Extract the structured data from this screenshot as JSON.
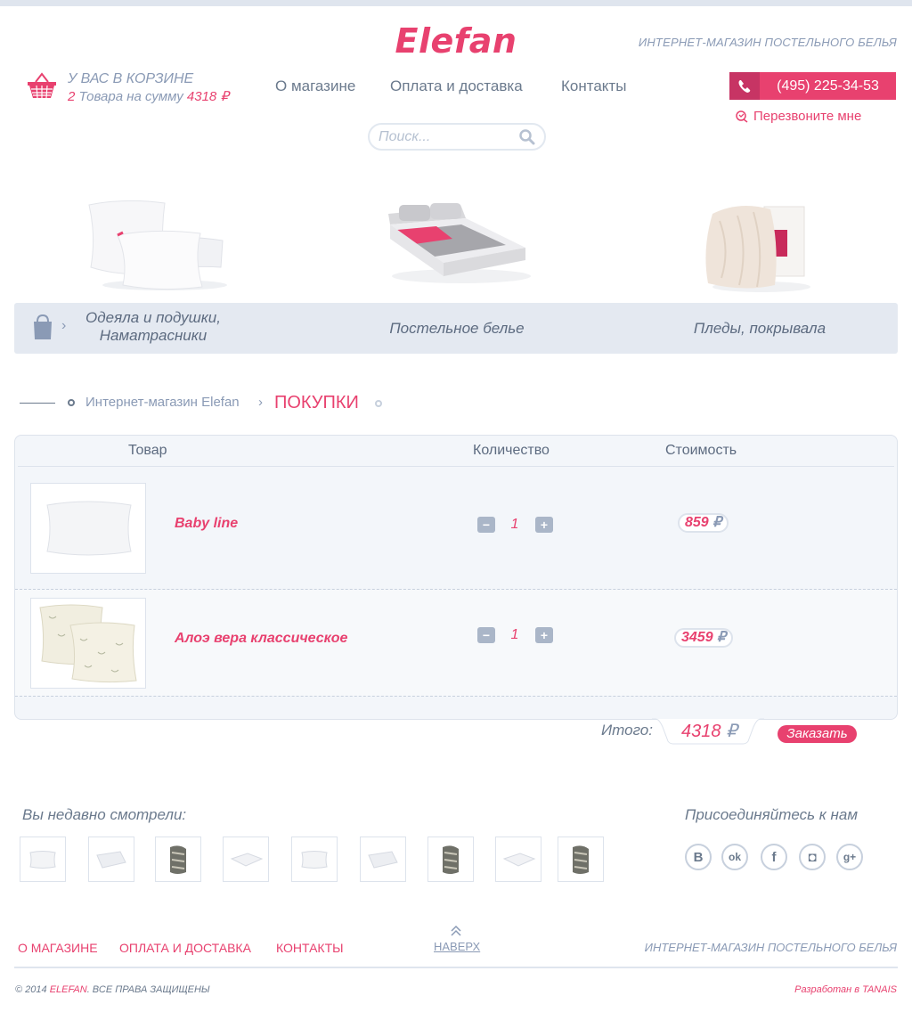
{
  "header": {
    "logo": "Elefan",
    "tagline": "ИНТЕРНЕТ-МАГАЗИН ПОСТЕЛЬНОГО БЕЛЬЯ",
    "cart_title": "У ВАС В КОРЗИНЕ",
    "cart_count": "2",
    "cart_goods_text": "Товара на сумму",
    "cart_sum": "4318",
    "currency": "₽",
    "nav": [
      "О магазине",
      "Оплата и доставка",
      "Контакты"
    ],
    "phone": "(495) 225-34-53",
    "callback": "Перезвоните мне",
    "search_placeholder": "Поиск..."
  },
  "categories": [
    {
      "label_line1": "Одеяла и подушки,",
      "label_line2": "Наматрасники",
      "icon": "pillows-image"
    },
    {
      "label_line1": "Постельное белье",
      "label_line2": "",
      "icon": "bed-image"
    },
    {
      "label_line1": "Пледы, покрывала",
      "label_line2": "",
      "icon": "blanket-image"
    }
  ],
  "breadcrumb": {
    "home": "Интернет-магазин Elefan",
    "separator": "›",
    "current": "ПОКУПКИ"
  },
  "cart_table": {
    "headers": {
      "product": "Товар",
      "quantity": "Количество",
      "cost": "Стоимость"
    },
    "items": [
      {
        "name": "Baby line",
        "quantity": "1",
        "price": "859",
        "image": "white-pillow-image"
      },
      {
        "name": "Алоэ вера классическое",
        "quantity": "1",
        "price": "3459",
        "image": "patterned-pillows-image"
      }
    ],
    "minus": "−",
    "plus": "+",
    "total_label": "Итого:",
    "total": "4318",
    "order_button": "Заказать"
  },
  "recent": {
    "title": "Вы недавно смотрели:",
    "items": [
      "pillow",
      "blanket",
      "throw",
      "folded-sheet",
      "pillow",
      "blanket",
      "throw",
      "folded-sheet",
      "throw"
    ]
  },
  "social": {
    "title": "Присоединяйтесь к нам",
    "networks": [
      {
        "name": "vk-icon",
        "glyph": "B"
      },
      {
        "name": "odnoklassniki-icon",
        "glyph": "ok"
      },
      {
        "name": "facebook-icon",
        "glyph": "f"
      },
      {
        "name": "instagram-icon",
        "glyph": "◘"
      },
      {
        "name": "google-plus-icon",
        "glyph": "g+"
      }
    ]
  },
  "footer": {
    "links": [
      "О МАГАЗИНЕ",
      "ОПЛАТА И ДОСТАВКА",
      "КОНТАКТЫ"
    ],
    "to_top": "НАВЕРХ",
    "tagline": "ИНТЕРНЕТ-МАГАЗИН ПОСТЕЛЬНОГО БЕЛЬЯ",
    "copyright_prefix": "© 2014",
    "copyright_brand": "ELEFAN",
    "copyright_suffix": ". ВСЕ ПРАВА ЗАЩИЩЕНЫ",
    "developer": "Разработан в TANAIS"
  },
  "colors": {
    "accent": "#e8416f",
    "muted": "#8a9ab5",
    "panel": "#e4e9f1"
  }
}
